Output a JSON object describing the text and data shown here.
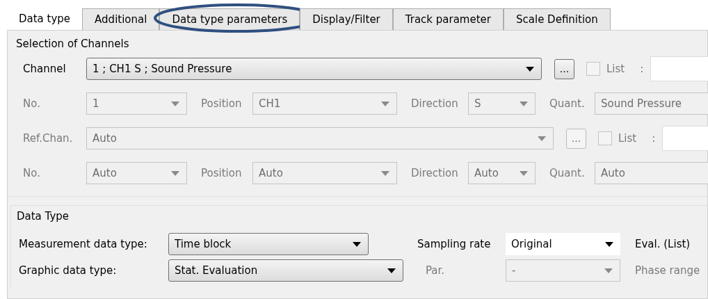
{
  "tabs": [
    {
      "label": "Data type",
      "selected": true,
      "circled": false
    },
    {
      "label": "Additional",
      "selected": false,
      "circled": false
    },
    {
      "label": "Data type parameters",
      "selected": false,
      "circled": true
    },
    {
      "label": "Display/Filter",
      "selected": false,
      "circled": false
    },
    {
      "label": "Track parameter",
      "selected": false,
      "circled": false
    },
    {
      "label": "Scale Definition",
      "selected": false,
      "circled": false
    }
  ],
  "channel_selection": {
    "title": "Selection of Channels",
    "channel": {
      "label": "Channel",
      "value": "1 ; CH1 S ; Sound Pressure",
      "disabled": false,
      "browse": "...",
      "list_label": "List",
      "list_checked": false,
      "list_disabled": true,
      "separator": ":"
    },
    "channel_details": {
      "disabled": true,
      "fields": [
        {
          "label": "No.",
          "value": "1"
        },
        {
          "label": "Position",
          "value": "CH1"
        },
        {
          "label": "Direction",
          "value": "S"
        },
        {
          "label": "Quant.",
          "value": "Sound Pressure"
        }
      ]
    },
    "ref_channel": {
      "label": "Ref.Chan.",
      "value": "Auto",
      "disabled": true,
      "browse": "...",
      "list_label": "List",
      "list_checked": false,
      "list_disabled": true,
      "separator": ":"
    },
    "ref_details": {
      "disabled": true,
      "fields": [
        {
          "label": "No.",
          "value": "Auto"
        },
        {
          "label": "Position",
          "value": "Auto"
        },
        {
          "label": "Direction",
          "value": "Auto"
        },
        {
          "label": "Quant.",
          "value": "Auto"
        }
      ]
    }
  },
  "data_type": {
    "title": "Data Type",
    "measurement": {
      "label": "Measurement data type:",
      "value": "Time block",
      "disabled": false
    },
    "graphic": {
      "label": "Graphic data type:",
      "value": "Stat. Evaluation",
      "disabled": false
    },
    "sampling_rate": {
      "label": "Sampling rate",
      "value": "Original",
      "disabled": false
    },
    "eval": {
      "label": "Eval. (List)",
      "disabled": false
    },
    "par": {
      "label": "Par.",
      "value": "-",
      "disabled": true
    },
    "phase_range": {
      "label": "Phase range",
      "disabled": true
    }
  }
}
